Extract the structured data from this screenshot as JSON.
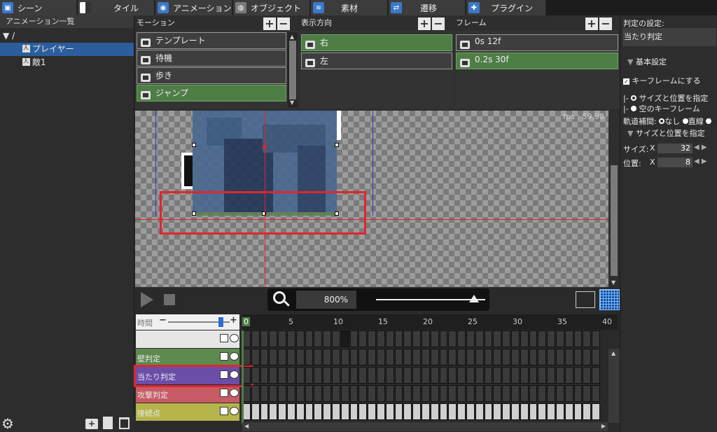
{
  "tabs": [
    {
      "label": "シーン",
      "icon": "scene-icon",
      "color": "#3a78c9"
    },
    {
      "label": "タイル",
      "icon": "tile-icon",
      "color": "#d9d9d9"
    },
    {
      "label": "アニメーション",
      "icon": "animation-icon",
      "color": "#3a78c9"
    },
    {
      "label": "オブジェクト",
      "icon": "object-icon",
      "color": "#b0b0b0"
    },
    {
      "label": "素材",
      "icon": "material-icon",
      "color": "#3a78c9"
    },
    {
      "label": "遷移",
      "icon": "transition-icon",
      "color": "#3a78c9"
    },
    {
      "label": "プラグイン",
      "icon": "plugin-icon",
      "color": "#3a78c9"
    }
  ],
  "left_panel": {
    "title": "アニメーション一覧",
    "root": "/",
    "items": [
      "プレイヤー",
      "敵1"
    ]
  },
  "motion": {
    "title": "モーション",
    "items": [
      "テンプレート",
      "待機",
      "歩き",
      "ジャンプ"
    ],
    "selected": 3
  },
  "direction": {
    "title": "表示方向",
    "items": [
      "右",
      "左"
    ],
    "selected": 0
  },
  "frame": {
    "title": "フレーム",
    "items": [
      "0s 12f",
      "0.2s 30f"
    ],
    "selected": 1
  },
  "canvas": {
    "fps": "fps : 59.98"
  },
  "toolbar": {
    "zoom": "800%",
    "zoom_level": 0.9
  },
  "timeline": {
    "time_label": "時間",
    "time_slider": 0.85,
    "ruler": [
      "0",
      "5",
      "10",
      "15",
      "20",
      "25",
      "30",
      "35",
      "40"
    ],
    "tracks": [
      {
        "label": "",
        "color": "#e6e6e6"
      },
      {
        "label": "壁判定",
        "color": "#5c8a4f"
      },
      {
        "label": "当たり判定",
        "color": "#6a4ea8"
      },
      {
        "label": "攻撃判定",
        "color": "#c85b66"
      },
      {
        "label": "接続点",
        "color": "#b5b54c"
      }
    ]
  },
  "right_panel": {
    "header": "判定の設定:",
    "value": "当たり判定",
    "section": "基本設定",
    "keyframe_checkbox": "キーフレームにする",
    "radio_size_pos": "サイズと位置を指定",
    "radio_empty": "空のキーフレーム",
    "interp_label": "軌道補間:",
    "interp_none": "なし",
    "interp_linear": "直線",
    "subsection": "サイズと位置を指定",
    "size_label": "サイズ:",
    "pos_label": "位置:",
    "x_label": "X",
    "size_x": "32",
    "pos_x": "8"
  },
  "colors": {
    "accent_green": "#4e7d46",
    "highlight_red": "#e0262c",
    "hitbox_purple": "#6a4ea8"
  }
}
